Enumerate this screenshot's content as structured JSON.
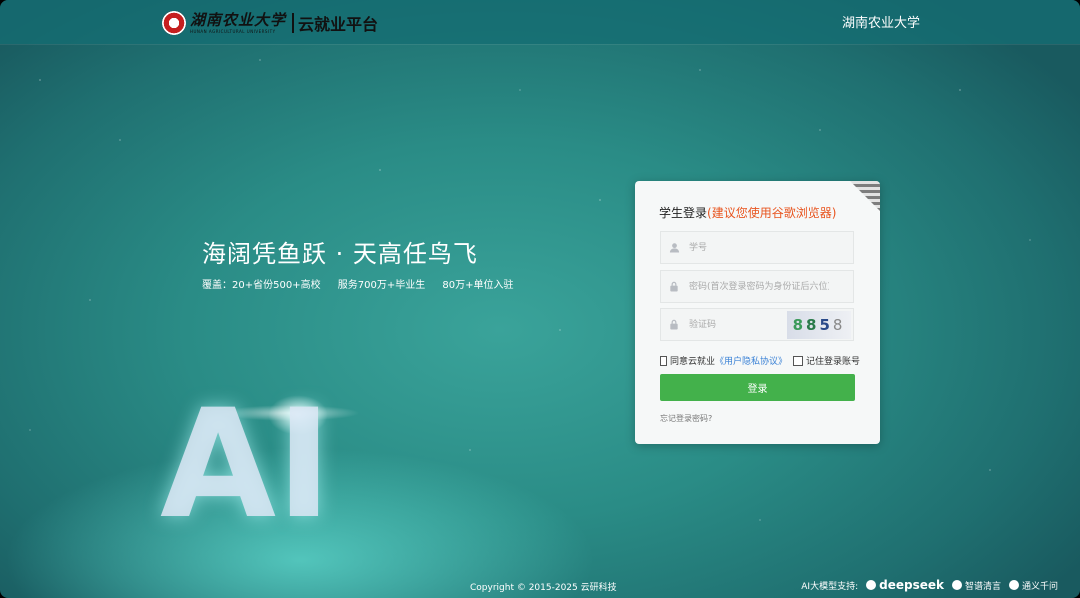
{
  "header": {
    "logo_cn": "湖南农业大学",
    "logo_en": "HUNAN AGRICULTURAL UNIVERSITY",
    "platform_name": "云就业平台",
    "university_link": "湖南农业大学"
  },
  "hero": {
    "slogan": "海阔凭鱼跃 · 天高任鸟飞",
    "stats": [
      "覆盖：20+省份500+高校",
      "服务700万+毕业生",
      "80万+单位入驻"
    ],
    "art_text": "AI"
  },
  "login": {
    "title": "学生登录",
    "browser_hint": "(建议您使用谷歌浏览器)",
    "username_placeholder": "学号",
    "password_placeholder": "密码(首次登录密码为身份证后六位)",
    "captcha_placeholder": "验证码",
    "captcha_chars": [
      "8",
      "8",
      "5",
      "8"
    ],
    "agree_prefix": "同意云就业",
    "privacy_link": "《用户隐私协议》",
    "remember_label": "记住登录账号",
    "submit_label": "登录",
    "forgot_label": "忘记登录密码?"
  },
  "footer": {
    "copyright": "Copyright © 2015-2025 云研科技",
    "ai_support_label": "AI大模型支持:",
    "providers": [
      "deepseek",
      "智谱清言",
      "通义千问"
    ]
  },
  "colors": {
    "accent_green": "#43b14b",
    "hint_orange": "#e8541e",
    "link_blue": "#3b82d6"
  }
}
